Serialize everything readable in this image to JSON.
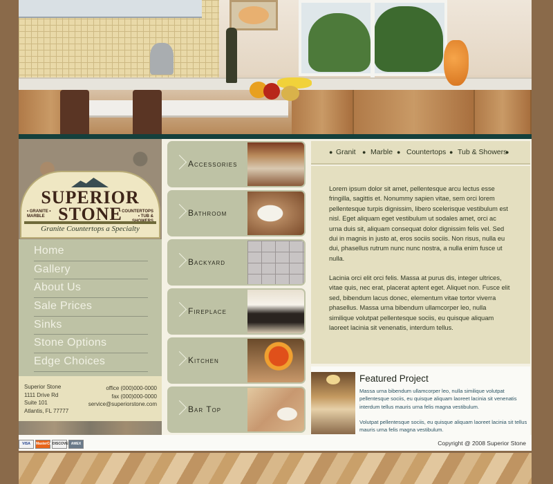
{
  "brand": {
    "name_line1": "SUPERIOR",
    "name_line2": "STONE",
    "tag_left": "• GRANITE • MARBLE",
    "tag_right": "• COUNTERTOPS • TUB & SHOWERS",
    "slogan": "Granite Countertops a Specialty"
  },
  "nav": {
    "items": [
      {
        "label": "Home"
      },
      {
        "label": "Gallery"
      },
      {
        "label": "About Us"
      },
      {
        "label": "Sale Prices"
      },
      {
        "label": "Sinks"
      },
      {
        "label": "Stone Options"
      },
      {
        "label": "Edge Choices"
      }
    ]
  },
  "address": {
    "company": "Superior Stone",
    "street": "1111 Drive Rd",
    "suite": "Suite 101",
    "city": "Atlantis, FL 77777",
    "office": "office (000)000-0000",
    "fax": "fax (000)000-0000",
    "email": "service@superiorstone.com"
  },
  "categories": [
    {
      "label": "Accessories"
    },
    {
      "label": "Bathroom"
    },
    {
      "label": "Backyard"
    },
    {
      "label": "Fireplace"
    },
    {
      "label": "Kitchen"
    },
    {
      "label": "Bar Top"
    }
  ],
  "topnav": {
    "items": [
      "Granit",
      "Marble",
      "Countertops",
      "Tub & Showers"
    ]
  },
  "content": {
    "para1": "Lorem ipsum dolor sit amet, pellentesque arcu lectus esse fringilla, sagittis et. Nonummy sapien vitae, sem orci lorem pellentesque turpis dignissim, libero scelerisque vestibulum est nisl. Eget aliquam eget vestibulum ut sodales amet, orci ac urna duis sit, aliquam consequat dolor dignissim felis vel. Sed dui in magnis in justo at, eros sociis sociis. Non risus, nulla eu dui, phasellus rutrum nunc nunc nostra, a nulla enim fusce ut nulla.",
    "para2": "Lacinia orci elit orci felis. Massa at purus dis, integer ultrices, vitae quis, nec erat, placerat aptent eget. Aliquet non. Fusce elit sed, bibendum lacus donec, elementum vitae tortor viverra phasellus. Massa urna bibendum ullamcorper leo, nulla similique volutpat pellentesque sociis, eu quisque aliquam laoreet lacinia sit venenatis, interdum tellus."
  },
  "featured": {
    "title": "Featured Project",
    "para1": "Massa urna bibendum ullamcorper leo, nulla similique volutpat pellentesque sociis, eu quisque aliquam laoreet lacinia sit venenatis interdum tellus mauris urna felis magna vestibulum.",
    "para2": "Volutpat pellentesque sociis, eu quisque aliquam laoreet lacinia sit tellus mauris urna felis magna vestibulum."
  },
  "footer": {
    "cards": [
      "VISA",
      "MasterCard",
      "DISCOVER",
      "AMEX"
    ],
    "copyright": "Copyright @ 2008 Superior Stone"
  },
  "colors": {
    "background": "#8a6a4a",
    "sage": "#bec2a5",
    "cream": "#e4dfc0",
    "divider": "#14403c"
  }
}
